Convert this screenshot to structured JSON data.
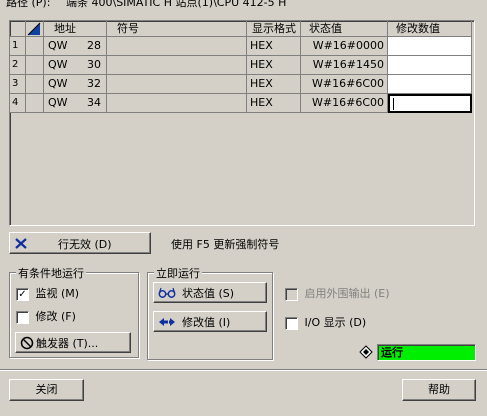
{
  "top": {
    "path_label": "路径 (P):",
    "path_value": "端条 400\\SIMATIC H 站点(1)\\CPU 412-5 H"
  },
  "table": {
    "headers": {
      "address": "地址",
      "symbol": "符号",
      "format": "显示格式",
      "status": "状态值",
      "modify": "修改数值"
    },
    "rows": [
      {
        "num": "1",
        "type": "QW",
        "addr": "28",
        "symbol": "",
        "format": "HEX",
        "status": "W#16#0000",
        "modify": ""
      },
      {
        "num": "2",
        "type": "QW",
        "addr": "30",
        "symbol": "",
        "format": "HEX",
        "status": "W#16#1450",
        "modify": ""
      },
      {
        "num": "3",
        "type": "QW",
        "addr": "32",
        "symbol": "",
        "format": "HEX",
        "status": "W#16#6C00",
        "modify": ""
      },
      {
        "num": "4",
        "type": "QW",
        "addr": "34",
        "symbol": "",
        "format": "HEX",
        "status": "W#16#6C00",
        "modify": ""
      }
    ]
  },
  "row_invalid_button": "行无效 (D)",
  "hint_text": "使用 F5 更新强制符号",
  "conditional_group": {
    "title": "有条件地运行",
    "monitor_label": "监视 (M)",
    "monitor_checked": true,
    "modify_label": "修改 (F)",
    "modify_checked": false,
    "trigger_button": "触发器 (T)..."
  },
  "immediate_group": {
    "title": "立即运行",
    "status_button": "状态值 (S)",
    "modify_button": "修改值 (I)"
  },
  "options": {
    "peripheral_label": "启用外围输出 (E)",
    "io_label": "I/O 显示 (D)"
  },
  "run_status": {
    "label": "运行",
    "color": "#00ee00"
  },
  "footer": {
    "close_button": "关闭",
    "help_button": "帮助"
  },
  "icons": {
    "row_invalid": "red-x-icon",
    "trigger": "no-sign-icon",
    "status": "glasses-icon",
    "modify": "arrows-icon",
    "run": "diamond-icon"
  }
}
